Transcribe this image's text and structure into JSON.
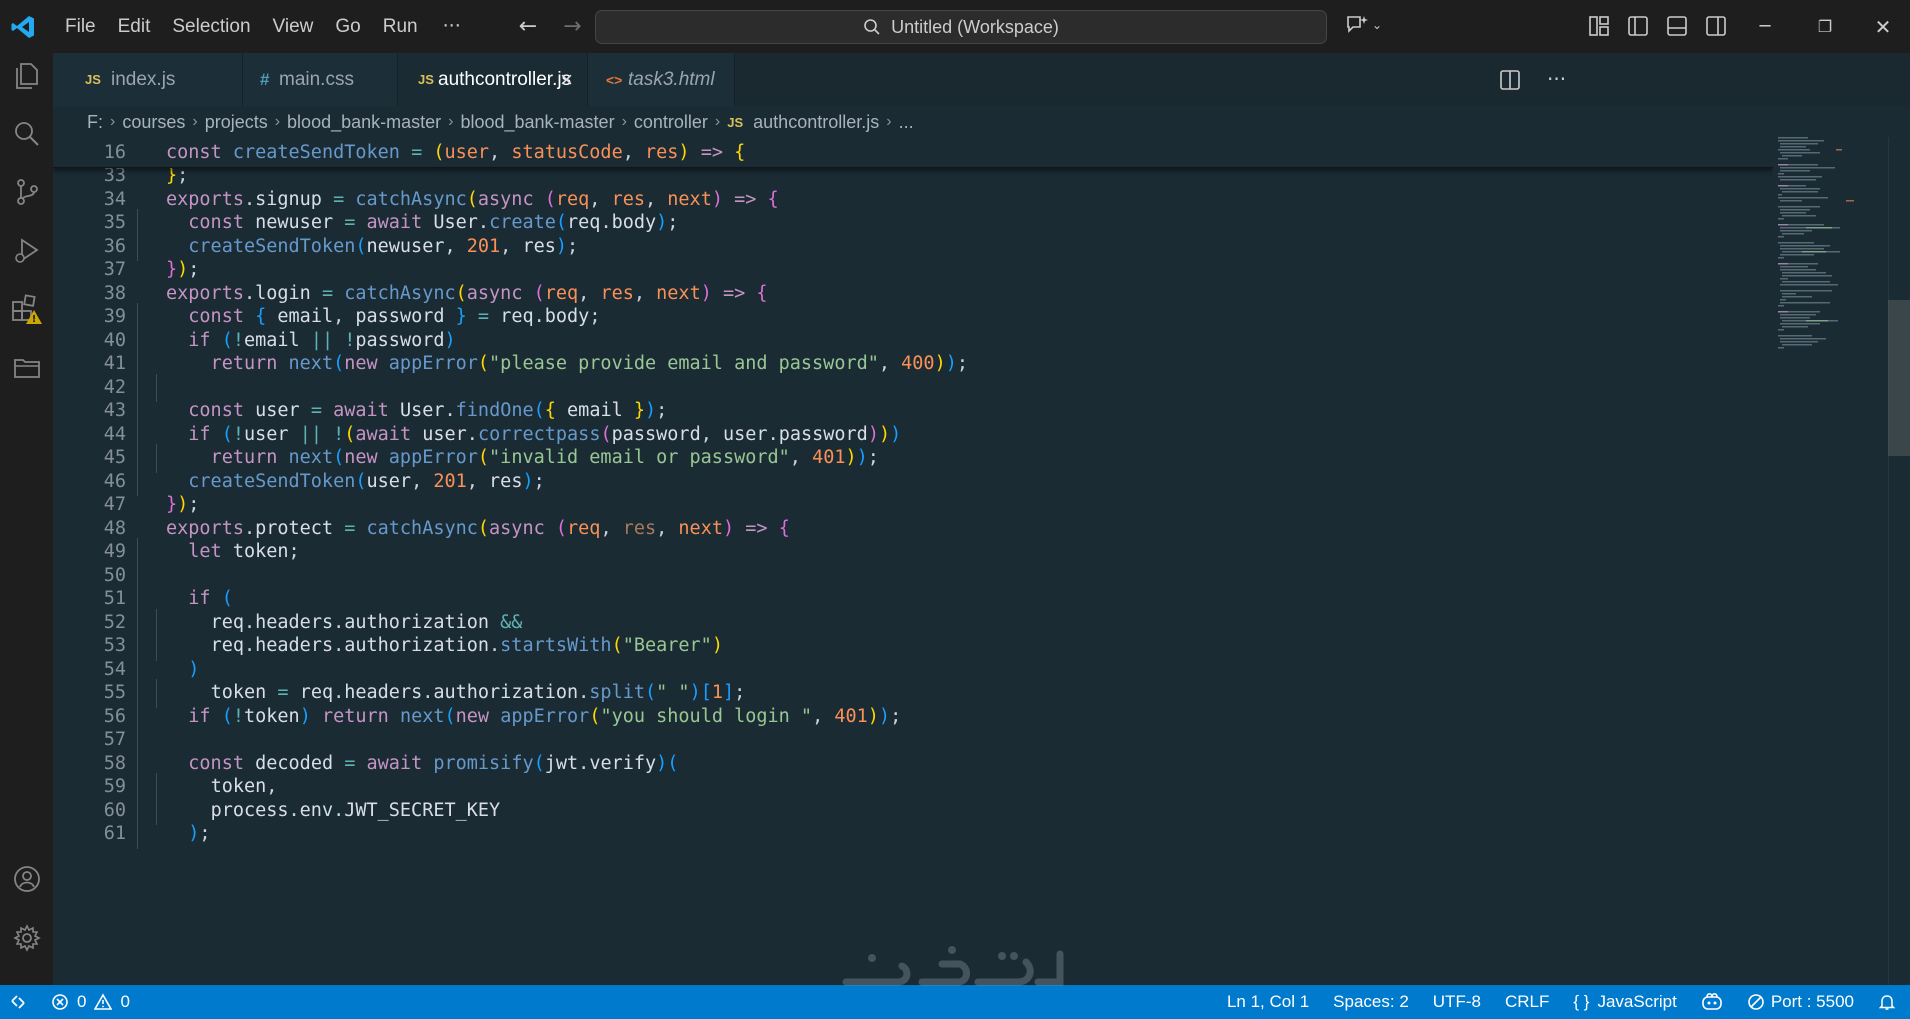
{
  "menu": [
    "File",
    "Edit",
    "Selection",
    "View",
    "Go",
    "Run"
  ],
  "menu_more": "···",
  "search_label": "Untitled (Workspace)",
  "tabs": [
    {
      "icon": "JS",
      "label": "index.js"
    },
    {
      "icon": "#",
      "label": "main.css"
    },
    {
      "icon": "JS",
      "label": "authcontroller.js",
      "close": "×"
    },
    {
      "icon": "<>",
      "label": "task3.html"
    }
  ],
  "breadcrumb": [
    "F:",
    "courses",
    "projects",
    "blood_bank-master",
    "blood_bank-master",
    "controller"
  ],
  "breadcrumb_file_icon": "JS",
  "breadcrumb_file": "authcontroller.js",
  "breadcrumb_more": "...",
  "lines": [
    "16",
    "33",
    "34",
    "35",
    "36",
    "37",
    "38",
    "39",
    "40",
    "41",
    "42",
    "43",
    "44",
    "45",
    "46",
    "47",
    "48",
    "49",
    "50",
    "51",
    "52",
    "53",
    "54",
    "55",
    "56",
    "57",
    "58",
    "59",
    "60",
    "61"
  ],
  "status": {
    "errors": "0",
    "warnings": "0",
    "position": "Ln 1, Col 1",
    "spaces": "Spaces: 2",
    "encoding": "UTF-8",
    "eol": "CRLF",
    "language_icon": "{ }",
    "language": "JavaScript",
    "port": "Port : 5500"
  },
  "colors": {
    "statusbar": "#007acc",
    "editor_bg": "#1b2b34",
    "keyword": "#c594c5",
    "function": "#6699cc",
    "string": "#99c794",
    "number": "#f99157"
  }
}
